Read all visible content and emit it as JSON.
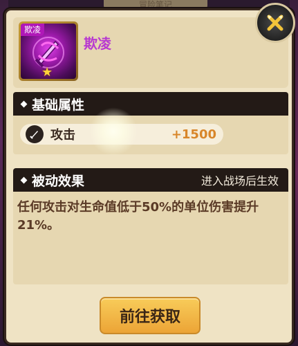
{
  "background": {
    "top_label": "冒险笔记"
  },
  "item": {
    "tag": "欺凌",
    "name": "欺凌",
    "icon": "magic-sword-icon",
    "star_icon": "star-icon",
    "stars": 1,
    "rarity_color": "#b018b8"
  },
  "close": {
    "icon": "crossed-swords-close-icon"
  },
  "basic": {
    "title": "基础属性",
    "attr_label": "攻击",
    "attr_value": "+1500",
    "attr_icon": "sword-icon",
    "value_color": "#d8862a"
  },
  "passive": {
    "title": "被动效果",
    "note": "进入战场后生效",
    "description": "任何攻击对生命值低于50%的单位伤害提升21%。"
  },
  "action": {
    "label": "前往获取"
  }
}
